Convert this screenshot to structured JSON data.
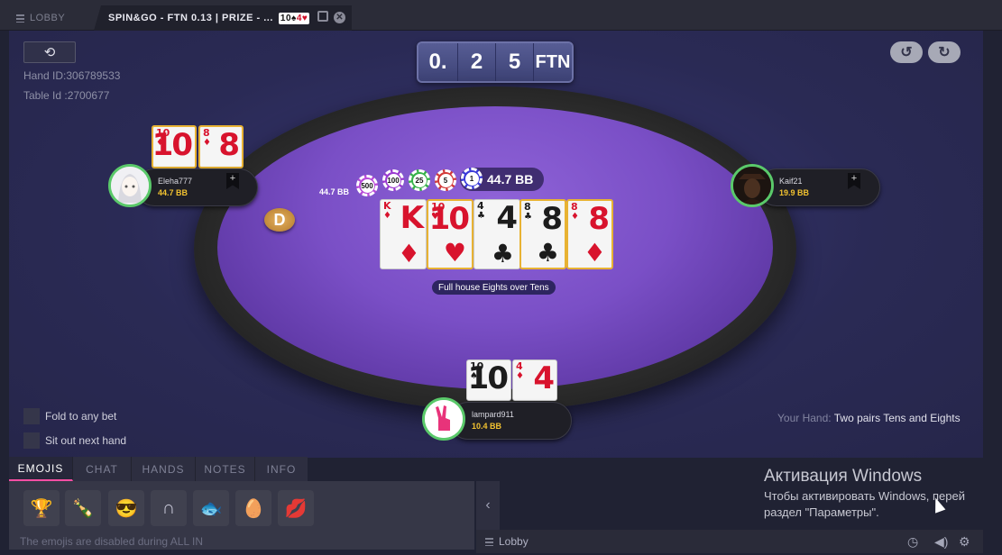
{
  "tabs": {
    "lobby_label": "LOBBY",
    "game_label": "SPIN&GO - FTN 0.13 | PRIZE - ...",
    "game_mini_cards": [
      "10",
      "♠",
      "4",
      "♥"
    ]
  },
  "table_info": {
    "hand_id": "Hand ID:306789533",
    "table_id": "Table Id :2700677"
  },
  "prize": {
    "digits": [
      "0.",
      "2",
      "5"
    ],
    "unit": "FTN"
  },
  "pot": {
    "amount": "44.7 BB",
    "side_amount": "44.7 BB",
    "chips": [
      {
        "label": "500",
        "color": "#b84bd8"
      },
      {
        "label": "100",
        "color": "#9a3ad0"
      },
      {
        "label": "25",
        "color": "#36b24a"
      },
      {
        "label": "5",
        "color": "#d23a3a"
      },
      {
        "label": "1",
        "color": "#3a3ad8"
      }
    ]
  },
  "board": {
    "cards": [
      {
        "rank": "K",
        "suit": "♦",
        "color": "red"
      },
      {
        "rank": "10",
        "suit": "♥",
        "color": "red"
      },
      {
        "rank": "4",
        "suit": "♣",
        "color": "black"
      },
      {
        "rank": "8",
        "suit": "♣",
        "color": "black"
      },
      {
        "rank": "8",
        "suit": "♦",
        "color": "red"
      }
    ],
    "hand_description": "Full house Eights over Tens"
  },
  "players": {
    "left": {
      "name": "Eleha777",
      "stack": "44.7 BB",
      "cards": [
        {
          "rank": "10",
          "suit": "♦"
        },
        {
          "rank": "8",
          "suit": "♦"
        }
      ]
    },
    "right": {
      "name": "Kaif21",
      "stack": "19.9 BB"
    },
    "hero": {
      "name": "lampard911",
      "stack": "10.4 BB",
      "cards": [
        {
          "rank": "10",
          "suit": "♠"
        },
        {
          "rank": "4",
          "suit": "♦"
        }
      ]
    }
  },
  "dealer_label": "D",
  "your_hand": {
    "label": "Your Hand:",
    "value": "Two pairs Tens and Eights"
  },
  "options": {
    "fold_any": "Fold to any bet",
    "sit_out": "Sit out next hand"
  },
  "bottom_tabs": [
    "EMOJIS",
    "CHAT",
    "HANDS",
    "NOTES",
    "INFO"
  ],
  "emojis": [
    "oscar-icon",
    "bottle-icon",
    "sunglasses-icon",
    "horseshoe-icon",
    "fish-icon",
    "egg-icon",
    "kiss-icon"
  ],
  "emoji_note": "The emojis are disabled during ALL IN",
  "status_bar": {
    "lobby": "Lobby"
  },
  "windows_activation": {
    "title": "Активация Windows",
    "line1": "Чтобы активировать Windows, перей",
    "line2": "раздел \"Параметры\"."
  }
}
